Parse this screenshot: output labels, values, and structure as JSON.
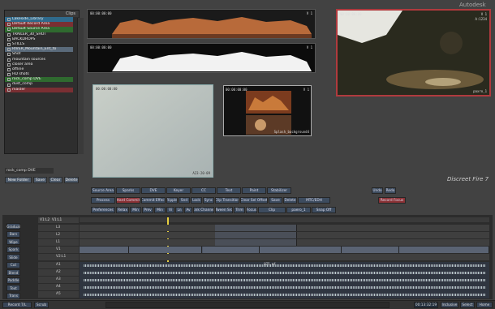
{
  "brand": "Autodesk",
  "product": "Discreet Fire 7",
  "library": {
    "header": "Clips",
    "rows": [
      {
        "label": "Lakeside_Library",
        "color": "#2f6a8c"
      },
      {
        "label": "Default Record Area",
        "color": "#7a2f33"
      },
      {
        "label": "Default Source Area",
        "color": "#2f6a2f"
      },
      {
        "label": "TRAILER_30_SHOT",
        "color": "#2e2e2e"
      },
      {
        "label": "BACKDROPS",
        "color": "#2e2e2e"
      },
      {
        "label": "STILLS",
        "color": "#2e2e2e"
      },
      {
        "label": "RIVER_Mountain_Ent_to",
        "color": "#5a6a7a"
      },
      {
        "label": "Shot",
        "color": "#2e2e2e"
      },
      {
        "label": "mountain sources",
        "color": "#2e2e2e"
      },
      {
        "label": "closer area",
        "color": "#2e2e2e"
      },
      {
        "label": "offline",
        "color": "#2e2e2e"
      },
      {
        "label": "HD shots",
        "color": "#2e2e2e"
      },
      {
        "label": "rock_comp DVE",
        "color": "#2f6a2f"
      },
      {
        "label": "dust_comp",
        "color": "#2e2e2e"
      },
      {
        "label": "master",
        "color": "#7a2f33"
      }
    ],
    "status": "rock_comp DVE",
    "buttons": [
      "New Folder",
      "Save",
      "Clear",
      "Delete"
    ]
  },
  "viewers": {
    "strip1": {
      "tc": "00:00:00:00",
      "layer": "V 1"
    },
    "strip2": {
      "tc": "00:00:00:00",
      "layer": "V 1"
    },
    "sky": {
      "tc": "00:00:00:00",
      "bottom": "A23-20-09"
    },
    "comp": {
      "tc": "00:00:00:00",
      "layer": "V 1",
      "label": "Splash_background4"
    },
    "record": {
      "tc": "00:00:00:00",
      "layer": "V 1",
      "label": "A:1234",
      "bottom": "paxro_1"
    }
  },
  "controls": {
    "row1": [
      "Source Area",
      "Sparks",
      "DVE",
      "Keyer",
      "CC",
      "Text",
      "Paint",
      "Stabilizer"
    ],
    "row2": [
      "Process",
      "Hard Commit",
      "Commit Effect",
      "Ripple",
      "Snd",
      "Lock",
      "Sync",
      "Clip Transition",
      "Clear Sel Offset",
      "Save",
      "Delete",
      "MTC/EDH"
    ],
    "row3": [
      "Preferences",
      "Relax",
      "Min",
      "Prev",
      "Min",
      "Vi",
      "Ln",
      "Av",
      "Link Channel",
      "Tween Src",
      "Trim",
      "Focus",
      "Clip",
      "paero_1",
      "Snap Off"
    ],
    "right": [
      "Undo",
      "Redo",
      "Record Focus"
    ]
  },
  "timeline": {
    "head": [
      "V1:L2",
      "V1:L1"
    ],
    "left_buttons": [
      "Gradual",
      "Bars",
      "Wipe",
      "Spark",
      "Slide",
      "Cut",
      "Blend",
      "Paddle",
      "Text",
      "Trans"
    ],
    "channels": [
      "L3",
      "L2",
      "L1",
      "V1",
      "V2:L1",
      "A1",
      "A2",
      "A3",
      "A4",
      "A5"
    ],
    "video_segs": [
      {
        "t": "00:00",
        "l": "H:2",
        "w": "H:2 0003"
      },
      {
        "t": "0001",
        "l": "0005",
        "w": "H:2"
      }
    ],
    "audio_label": "075.mf",
    "end_tc": "00:13:40:00"
  },
  "bottom": {
    "record": "Record T/L",
    "scrub": "Scrub",
    "tc": "00:13:32:19",
    "inclusive": "Inclusive",
    "select": "Select",
    "home": "Home"
  }
}
